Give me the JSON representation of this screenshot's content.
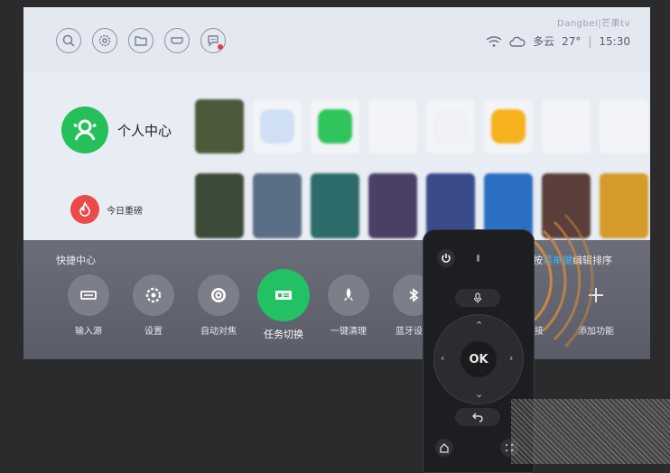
{
  "brand": "Dangbei|芒果tv",
  "status": {
    "weather": "多云",
    "temperature": "27°",
    "time": "15:30"
  },
  "top_icons": [
    "search-icon",
    "settings-icon",
    "folder-icon",
    "hdmi-icon",
    "message-icon"
  ],
  "profile": {
    "label": "个人中心"
  },
  "today": {
    "label": "今日重磅"
  },
  "tiles_row1": [
    {
      "kind": "poster",
      "color": "#4a5a3a"
    },
    {
      "kind": "app",
      "color": "#cfe0f5"
    },
    {
      "kind": "app",
      "color": "#2fc55c"
    },
    {
      "kind": "app",
      "color": "#f1f3f7"
    },
    {
      "kind": "app",
      "color": "#f0f1f5"
    },
    {
      "kind": "app",
      "color": "#f5b21d"
    },
    {
      "kind": "app",
      "color": "#f2f3f6"
    },
    {
      "kind": "app",
      "color": "#f2f3f6"
    }
  ],
  "tiles_row2": [
    {
      "color": "#3c4a38"
    },
    {
      "color": "#5a6e86"
    },
    {
      "color": "#2c6b6a"
    },
    {
      "color": "#4b3f66"
    },
    {
      "color": "#3a4a8a"
    },
    {
      "color": "#2b6fc2"
    },
    {
      "color": "#5a3f3a"
    },
    {
      "color": "#d49a2a"
    }
  ],
  "panel": {
    "title": "快捷中心",
    "hint_prefix": "按",
    "hint_key": "菜单键",
    "hint_suffix": "编辑排序"
  },
  "quick_items": [
    {
      "label": "输入源",
      "icon": "input-source-icon"
    },
    {
      "label": "设置",
      "icon": "gear-icon"
    },
    {
      "label": "自动对焦",
      "icon": "focus-icon"
    },
    {
      "label": "任务切换",
      "icon": "task-switch-icon",
      "active": true
    },
    {
      "label": "一键清理",
      "icon": "rocket-icon"
    },
    {
      "label": "蓝牙设置",
      "icon": "bluetooth-icon"
    }
  ],
  "extra_items": [
    {
      "label": "连接"
    },
    {
      "label": "添加功能"
    }
  ],
  "remote": {
    "ok_label": "OK"
  }
}
